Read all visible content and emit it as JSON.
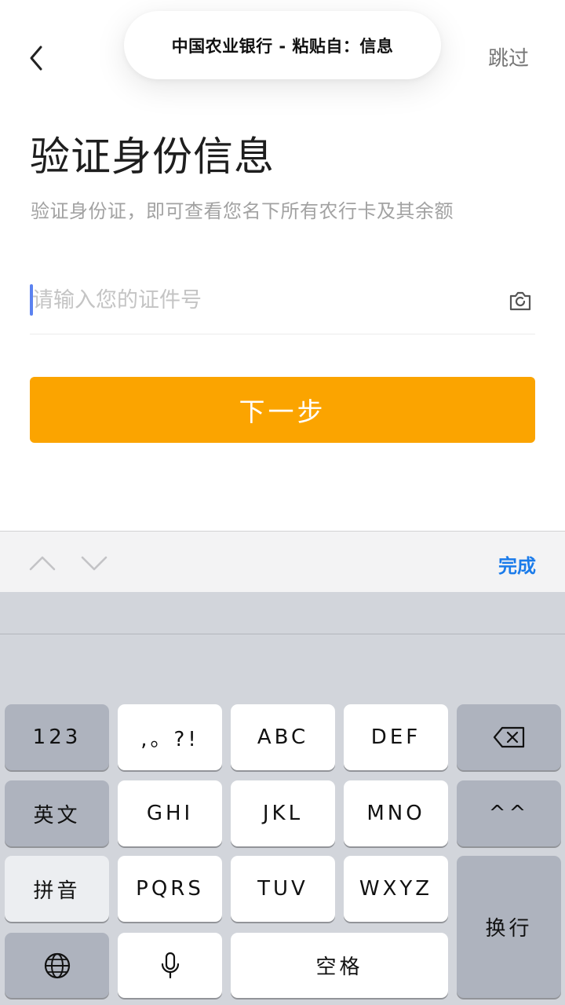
{
  "nav": {
    "back_icon": "chevron-left-icon",
    "paste_banner": "中国农业银行 - 粘贴自：信息",
    "skip_label": "跳过"
  },
  "header": {
    "title": "验证身份信息",
    "subtitle": "验证身份证，即可查看您名下所有农行卡及其余额"
  },
  "form": {
    "id_placeholder": "请输入您的证件号",
    "id_value": "",
    "camera_icon": "camera-icon",
    "next_label": "下一步"
  },
  "accessory": {
    "prev_icon": "chevron-up-icon",
    "next_icon": "chevron-down-icon",
    "done_label": "完成"
  },
  "keyboard": {
    "row1": [
      "123",
      ",。?!",
      "ABC",
      "DEF"
    ],
    "row2": [
      "英文",
      "GHI",
      "JKL",
      "MNO",
      "^^"
    ],
    "row3": [
      "拼音",
      "PQRS",
      "TUV",
      "WXYZ"
    ],
    "return_label": "换行",
    "space_label": "空格",
    "delete_icon": "backspace-icon",
    "globe_icon": "globe-icon",
    "mic_icon": "microphone-icon"
  },
  "colors": {
    "accent": "#fba400",
    "link_blue": "#1a7bea",
    "caret_blue": "#5b82f0",
    "keyboard_bg": "#d2d5db",
    "key_dark": "#aeb3be"
  }
}
